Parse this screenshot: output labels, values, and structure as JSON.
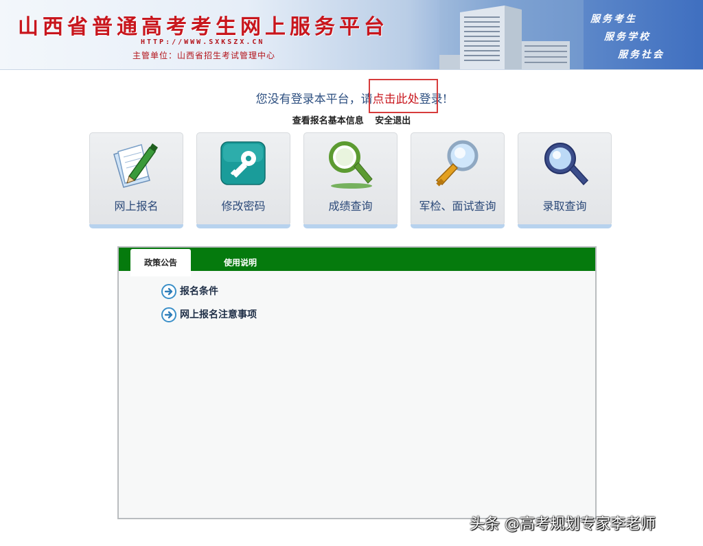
{
  "banner": {
    "title": "山西省普通高考考生网上服务平台",
    "url": "HTTP://WWW.SXKSZX.CN",
    "sponsor": "主管单位：山西省招生考试管理中心",
    "mottos": [
      "服务考生",
      "服务学校",
      "服务社会"
    ]
  },
  "login": {
    "prefix": "您没有登录本平台，请",
    "link_label": "点击此处",
    "suffix": "登录!"
  },
  "sub_links": {
    "view_info": "查看报名基本信息",
    "logout": "安全退出"
  },
  "tiles": [
    {
      "label": "网上报名",
      "icon": "pencil-paper-icon"
    },
    {
      "label": "修改密码",
      "icon": "key-icon"
    },
    {
      "label": "成绩查询",
      "icon": "magnifier-green-icon"
    },
    {
      "label": "军检、面试查询",
      "icon": "magnifier-gold-icon"
    },
    {
      "label": "录取查询",
      "icon": "magnifier-blue-icon"
    }
  ],
  "panel": {
    "tabs": [
      {
        "label": "政策公告",
        "active": true
      },
      {
        "label": "使用说明",
        "active": false
      }
    ],
    "items": [
      "报名条件",
      "网上报名注意事项"
    ]
  },
  "watermark": "头条 @高考规划专家李老师",
  "colors": {
    "title_red": "#c8161d",
    "tab_green": "#057a0d",
    "label_blue": "#2a4878"
  }
}
